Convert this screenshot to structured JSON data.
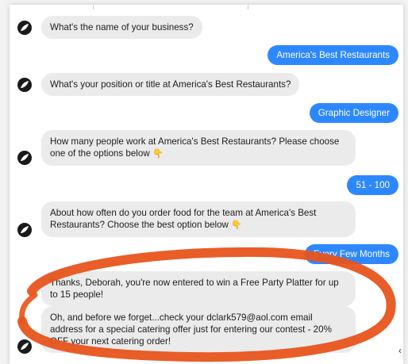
{
  "colors": {
    "user_bubble": "#2d88ff",
    "bot_bubble": "#ebebeb",
    "annotation": "#e8541c"
  },
  "messages": [
    {
      "from": "bot",
      "text": "What's the name of your business?"
    },
    {
      "from": "user",
      "text": "America's Best Restaurants"
    },
    {
      "from": "bot",
      "text": "What's your position or title at America's Best Restaurants?"
    },
    {
      "from": "user",
      "text": "Graphic Designer"
    },
    {
      "from": "bot",
      "text": "How many people work at America's Best Restaurants? Please choose one of the options below",
      "icon": "pointing-hand-emoji"
    },
    {
      "from": "user",
      "text": "51 - 100"
    },
    {
      "from": "bot",
      "text": "About how often do you order food for the team at America's Best Restaurants? Choose the best option below",
      "icon": "pointing-hand-emoji"
    },
    {
      "from": "user",
      "text": "Every Few Months"
    },
    {
      "from": "bot",
      "text": "Thanks, Deborah, you're now entered to win a Free Party Platter for up to 15 people!"
    },
    {
      "from": "bot",
      "text": "Oh, and before we forget...check your dclark579@aol.com email address for a special catering offer just for entering our contest - 20% OFF your next catering order!"
    }
  ]
}
